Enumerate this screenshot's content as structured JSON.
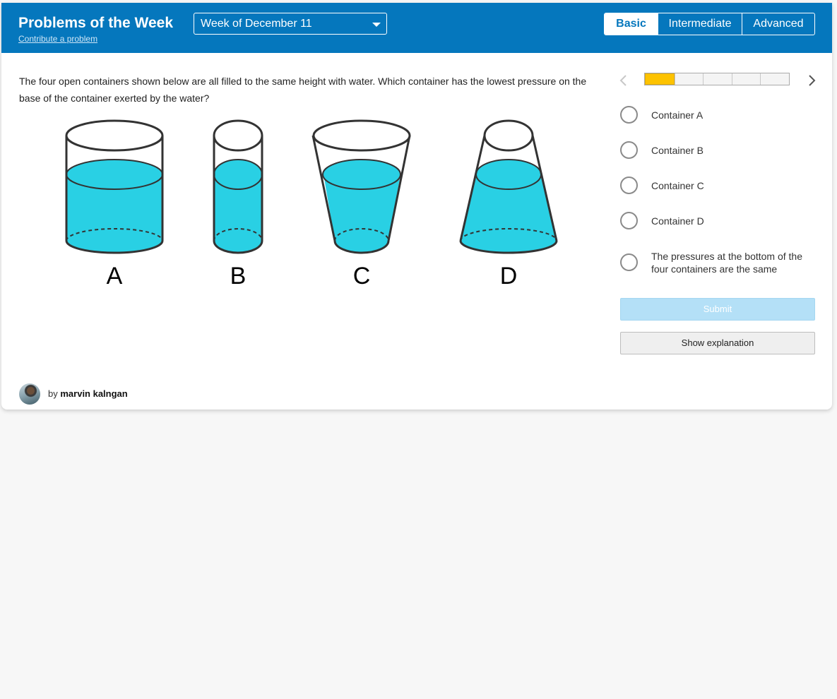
{
  "header": {
    "title": "Problems of the Week",
    "contribute_link": "Contribute a problem",
    "week_select": {
      "selected": "Week of December 11"
    },
    "levels": [
      {
        "label": "Basic",
        "active": true
      },
      {
        "label": "Intermediate",
        "active": false
      },
      {
        "label": "Advanced",
        "active": false
      }
    ]
  },
  "question": {
    "text": "The four open containers shown below are all filled to the same height with water. Which container has the lowest pressure on the base of the container exerted by the water?",
    "figure": {
      "container_labels": [
        "A",
        "B",
        "C",
        "D"
      ],
      "water_color": "#29d0e4"
    }
  },
  "progress": {
    "current": 1,
    "total": 5
  },
  "options": [
    {
      "label": "Container A"
    },
    {
      "label": "Container B"
    },
    {
      "label": "Container C"
    },
    {
      "label": "Container D"
    },
    {
      "label": "The pressures at the bottom of the four containers are the same"
    }
  ],
  "buttons": {
    "submit": "Submit",
    "explanation": "Show explanation"
  },
  "author": {
    "prefix": "by",
    "name": "marvin kalngan"
  },
  "colors": {
    "header_bg": "#0577bd",
    "progress_fill": "#fdc300",
    "submit_bg": "#b4e0f7"
  },
  "icons": {
    "prev": "chevron-left-icon",
    "next": "chevron-right-icon",
    "dropdown": "caret-down-icon"
  }
}
